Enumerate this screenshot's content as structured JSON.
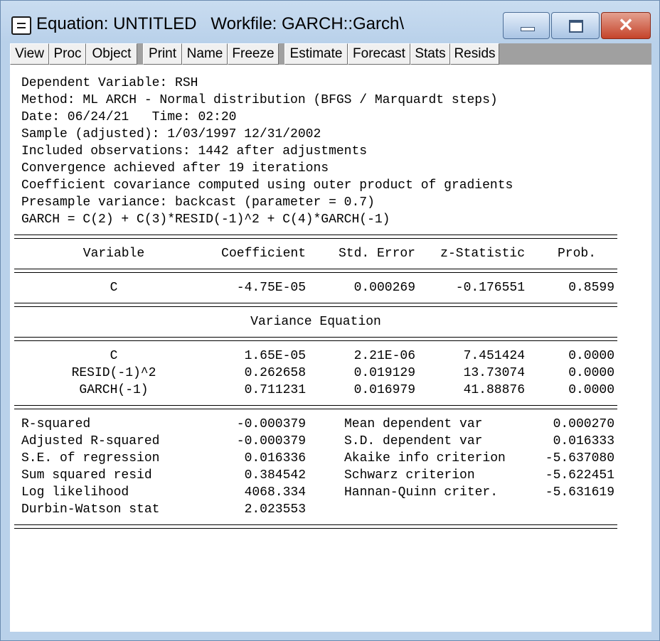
{
  "window": {
    "title": "Equation: UNTITLED   Workfile: GARCH::Garch\\"
  },
  "toolbar": {
    "buttons": [
      "View",
      "Proc",
      "Object",
      "Print",
      "Name",
      "Freeze",
      "Estimate",
      "Forecast",
      "Stats",
      "Resids"
    ]
  },
  "header_lines": [
    "Dependent Variable: RSH",
    "Method: ML ARCH - Normal distribution (BFGS / Marquardt steps)",
    "Date: 06/24/21   Time: 02:20",
    "Sample (adjusted): 1/03/1997 12/31/2002",
    "Included observations: 1442 after adjustments",
    "Convergence achieved after 19 iterations",
    "Coefficient covariance computed using outer product of gradients",
    "Presample variance: backcast (parameter = 0.7)",
    "GARCH = C(2) + C(3)*RESID(-1)^2 + C(4)*GARCH(-1)"
  ],
  "table": {
    "columns": [
      "Variable",
      "Coefficient",
      "Std. Error",
      "z-Statistic",
      "Prob."
    ],
    "mean_rows": [
      [
        "C",
        "-4.75E-05",
        "0.000269",
        "-0.176551",
        "0.8599"
      ]
    ],
    "variance_title": "Variance Equation",
    "variance_rows": [
      [
        "C",
        "1.65E-05",
        "2.21E-06",
        "7.451424",
        "0.0000"
      ],
      [
        "RESID(-1)^2",
        "0.262658",
        "0.019129",
        "13.73074",
        "0.0000"
      ],
      [
        "GARCH(-1)",
        "0.711231",
        "0.016979",
        "41.88876",
        "0.0000"
      ]
    ]
  },
  "stats": [
    [
      "R-squared",
      "-0.000379",
      "Mean dependent var",
      "0.000270"
    ],
    [
      "Adjusted R-squared",
      "-0.000379",
      "S.D. dependent var",
      "0.016333"
    ],
    [
      "S.E. of regression",
      "0.016336",
      "Akaike info criterion",
      "-5.637080"
    ],
    [
      "Sum squared resid",
      "0.384542",
      "Schwarz criterion",
      "-5.622451"
    ],
    [
      "Log likelihood",
      "4068.334",
      "Hannan-Quinn criter.",
      "-5.631619"
    ],
    [
      "Durbin-Watson stat",
      "2.023553",
      "",
      ""
    ]
  ]
}
